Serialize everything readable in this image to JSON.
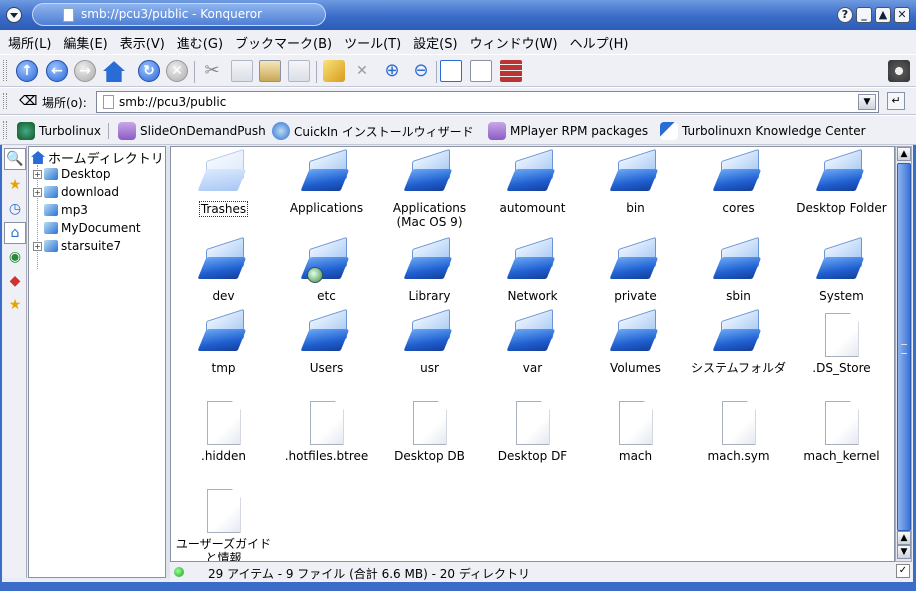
{
  "window": {
    "title": "smb://pcu3/public - Konqueror"
  },
  "menu": {
    "items": [
      "場所(L)",
      "編集(E)",
      "表示(V)",
      "進む(G)",
      "ブックマーク(B)",
      "ツール(T)",
      "設定(S)",
      "ウィンドウ(W)",
      "ヘルプ(H)"
    ]
  },
  "toolbar": {
    "icons": [
      "up-arrow-icon",
      "back-arrow-icon",
      "forward-arrow-icon",
      "home-icon",
      "reload-icon",
      "stop-icon",
      "cut-icon",
      "copy-icon",
      "paste-icon",
      "print-icon",
      "new-folder-icon",
      "delete-icon",
      "zoom-in-icon",
      "zoom-out-icon",
      "icon-view-icon",
      "list-view-icon",
      "firewall-icon"
    ]
  },
  "location": {
    "label": "場所(o):",
    "url": "smb://pcu3/public"
  },
  "bookmarks": [
    "Turbolinux",
    "SlideOnDemandPush",
    "CuickIn インストールウィザード",
    "MPlayer RPM packages",
    "Turbolinuxn Knowledge Center"
  ],
  "tree": {
    "root": "ホームディレクトリ",
    "nodes": [
      {
        "label": "Desktop",
        "expandable": true
      },
      {
        "label": "download",
        "expandable": true
      },
      {
        "label": "mp3",
        "expandable": false
      },
      {
        "label": "MyDocument",
        "expandable": false
      },
      {
        "label": "starsuite7",
        "expandable": true
      }
    ]
  },
  "files": [
    {
      "name": "Trashes",
      "kind": "folder-ghost",
      "selected": true
    },
    {
      "name": "Applications",
      "kind": "folder"
    },
    {
      "name": "Applications (Mac OS 9)",
      "kind": "folder"
    },
    {
      "name": "automount",
      "kind": "folder"
    },
    {
      "name": "bin",
      "kind": "folder"
    },
    {
      "name": "cores",
      "kind": "folder"
    },
    {
      "name": "Desktop Folder",
      "kind": "folder"
    },
    {
      "name": "dev",
      "kind": "folder"
    },
    {
      "name": "etc",
      "kind": "folder-link"
    },
    {
      "name": "Library",
      "kind": "folder"
    },
    {
      "name": "Network",
      "kind": "folder"
    },
    {
      "name": "private",
      "kind": "folder"
    },
    {
      "name": "sbin",
      "kind": "folder"
    },
    {
      "name": "System",
      "kind": "folder"
    },
    {
      "name": "tmp",
      "kind": "folder"
    },
    {
      "name": "Users",
      "kind": "folder"
    },
    {
      "name": "usr",
      "kind": "folder"
    },
    {
      "name": "var",
      "kind": "folder"
    },
    {
      "name": "Volumes",
      "kind": "folder"
    },
    {
      "name": "システムフォルダ",
      "kind": "folder"
    },
    {
      "name": ".DS_Store",
      "kind": "document"
    },
    {
      "name": ".hidden",
      "kind": "document"
    },
    {
      "name": ".hotfiles.btree",
      "kind": "document"
    },
    {
      "name": "Desktop DB",
      "kind": "document"
    },
    {
      "name": "Desktop DF",
      "kind": "document"
    },
    {
      "name": "mach",
      "kind": "document"
    },
    {
      "name": "mach.sym",
      "kind": "document"
    },
    {
      "name": "mach_kernel",
      "kind": "document"
    },
    {
      "name": "ユーザーズガイドと情報",
      "kind": "document"
    }
  ],
  "status": {
    "text": "29 アイテム - 9 ファイル (合計 6.6 MB) - 20 ディレクトリ"
  }
}
